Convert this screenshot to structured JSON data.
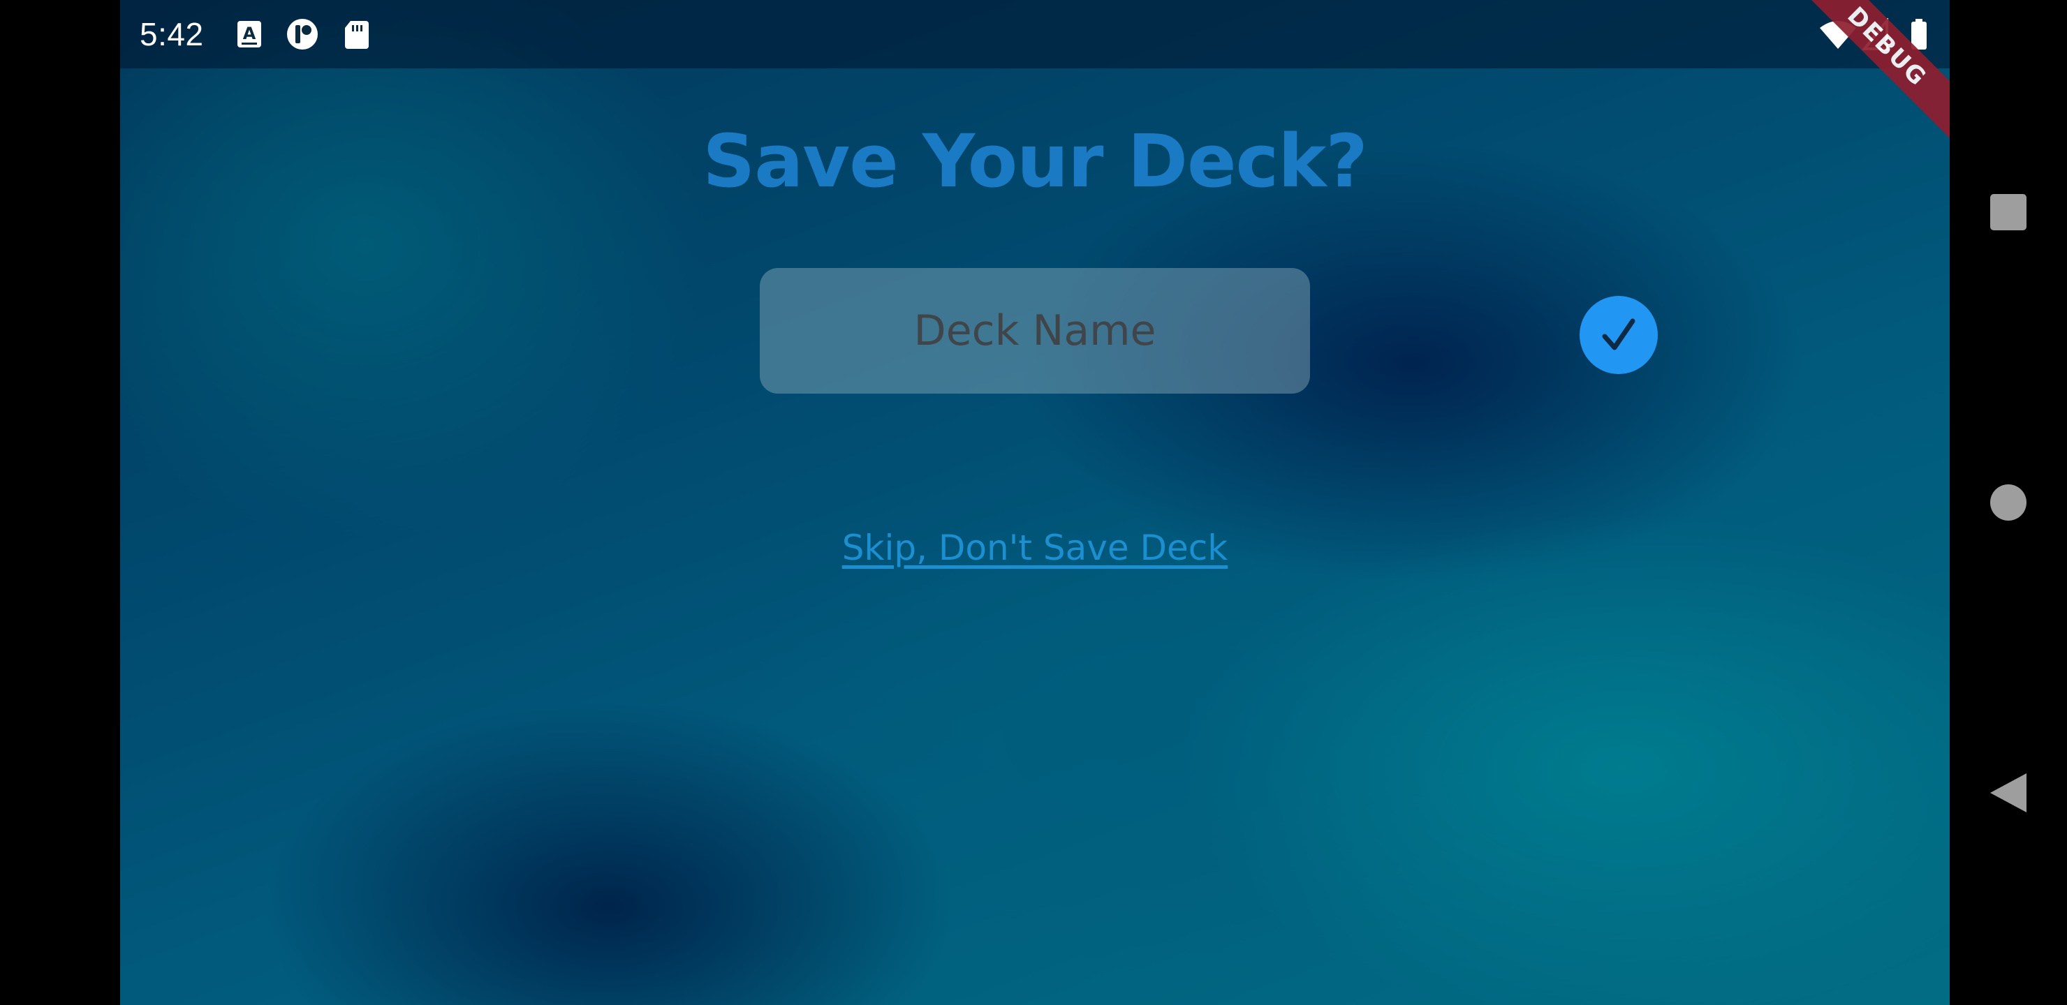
{
  "status_bar": {
    "time": "5:42",
    "left_icons": [
      "keyboard-a-icon",
      "app-circle-icon",
      "sd-card-icon"
    ],
    "right_icons": [
      "wifi-icon",
      "signal-icon",
      "battery-icon"
    ]
  },
  "debug_banner": "DEBUG",
  "page": {
    "title": "Save Your Deck?",
    "deck_name_placeholder": "Deck Name",
    "deck_name_value": "",
    "skip_link": "Skip, Don't Save Deck"
  },
  "colors": {
    "title": "#1a7bc4",
    "confirm_button": "#2196f3",
    "link": "#1c8fd0",
    "debug_banner": "#8e1f2f"
  },
  "nav_bar": {
    "buttons": [
      "recents-square-icon",
      "home-circle-icon",
      "back-triangle-icon"
    ]
  }
}
